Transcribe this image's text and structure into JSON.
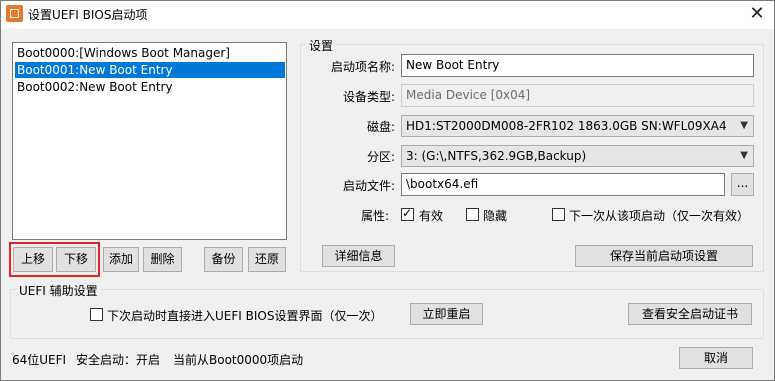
{
  "window": {
    "title": "设置UEFI BIOS启动项",
    "close_glyph": "✕"
  },
  "boot_list": {
    "items": [
      "Boot0000:[Windows Boot Manager]",
      "Boot0001:New Boot Entry",
      "Boot0002:New Boot Entry"
    ],
    "selected_index": 1
  },
  "list_buttons": {
    "move_up": "上移",
    "move_down": "下移",
    "add": "添加",
    "delete": "删除",
    "backup": "备份",
    "restore": "还原"
  },
  "settings": {
    "group_label": "设置",
    "name_label": "启动项名称:",
    "name_value": "New Boot Entry",
    "device_type_label": "设备类型:",
    "device_type_value": "Media Device [0x04]",
    "disk_label": "磁盘:",
    "disk_value": "HD1:ST2000DM008-2FR102 1863.0GB SN:WFL09XA4",
    "partition_label": "分区:",
    "partition_value": "3: (G:\\,NTFS,362.9GB,Backup)",
    "boot_file_label": "启动文件:",
    "boot_file_value": "\\bootx64.efi",
    "browse_label": "...",
    "attributes_label": "属性:",
    "attr_valid": {
      "label": "有效",
      "checked": true
    },
    "attr_hidden": {
      "label": "隐藏",
      "checked": false
    },
    "attr_next_once": {
      "label": "下一次从该项启动（仅一次有效）",
      "checked": false
    },
    "details_button": "详细信息",
    "save_button": "保存当前启动项设置"
  },
  "uefi_aux": {
    "group_label": "UEFI 辅助设置",
    "enter_bios_checkbox": {
      "label": "下次启动时直接进入UEFI BIOS设置界面（仅一次）",
      "checked": false
    },
    "restart_button": "立即重启",
    "secure_cert_button": "查看安全启动证书"
  },
  "status": {
    "uefi_bits": "64位UEFI",
    "secure_boot": "安全启动：开启",
    "current_boot": "当前从Boot0000项启动"
  },
  "cancel_button": "取消",
  "colors": {
    "selection": "#0078d7",
    "highlight_box": "#e0242a",
    "app_icon": "#e8782a"
  }
}
